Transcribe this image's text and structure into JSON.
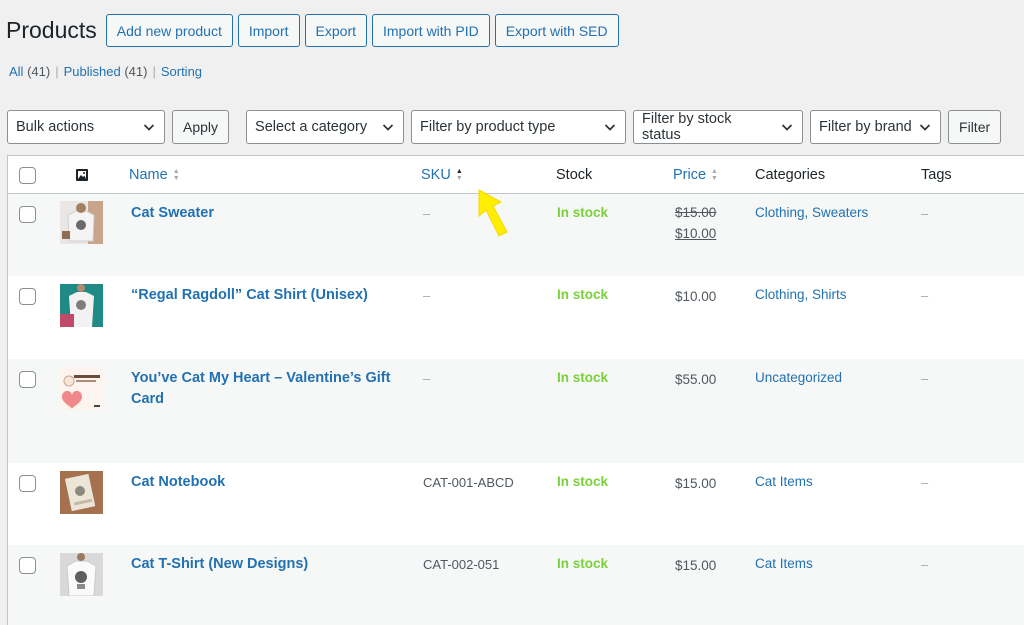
{
  "header": {
    "title": "Products",
    "buttons": [
      "Add new product",
      "Import",
      "Export",
      "Import with PID",
      "Export with SED"
    ]
  },
  "views": {
    "all_label": "All",
    "all_count": "(41)",
    "published_label": "Published",
    "published_count": "(41)",
    "sorting_label": "Sorting"
  },
  "filters": {
    "bulk_actions": "Bulk actions",
    "apply": "Apply",
    "category": "Select a category",
    "product_type": "Filter by product type",
    "stock_status": "Filter by stock status",
    "brand": "Filter by brand",
    "filter": "Filter"
  },
  "columns": {
    "name": "Name",
    "sku": "SKU",
    "stock": "Stock",
    "price": "Price",
    "categories": "Categories",
    "tags": "Tags"
  },
  "products": [
    {
      "name": "Cat Sweater",
      "name_line2": "",
      "sku": "–",
      "stock": "In stock",
      "price_regular": "$15.00",
      "price_sale": "$10.00",
      "categories": "Clothing, Sweaters",
      "tags": "–",
      "thumb": "sweater"
    },
    {
      "name": "“Regal Ragdoll” Cat Shirt (Unisex)",
      "name_line2": "",
      "sku": "–",
      "stock": "In stock",
      "price_regular": "",
      "price_sale": "$10.00",
      "categories": "Clothing, Shirts",
      "tags": "–",
      "thumb": "shirt"
    },
    {
      "name": "You’ve Cat My Heart – Valentine’s Gift",
      "name_line2": "Card",
      "sku": "–",
      "stock": "In stock",
      "price_regular": "",
      "price_sale": "$55.00",
      "categories": "Uncategorized",
      "tags": "–",
      "thumb": "giftcard"
    },
    {
      "name": "Cat Notebook",
      "name_line2": "",
      "sku": "CAT-001-ABCD",
      "stock": "In stock",
      "price_regular": "",
      "price_sale": "$15.00",
      "categories": "Cat Items",
      "tags": "–",
      "thumb": "notebook"
    },
    {
      "name": "Cat T-Shirt (New Designs)",
      "name_line2": "",
      "sku": "CAT-002-051",
      "stock": "In stock",
      "price_regular": "",
      "price_sale": "$15.00",
      "categories": "Cat Items",
      "tags": "–",
      "thumb": "tshirt"
    }
  ],
  "colors": {
    "link": "#2271b1",
    "in_stock": "#7ad03a",
    "cursor": "#ffee00"
  }
}
